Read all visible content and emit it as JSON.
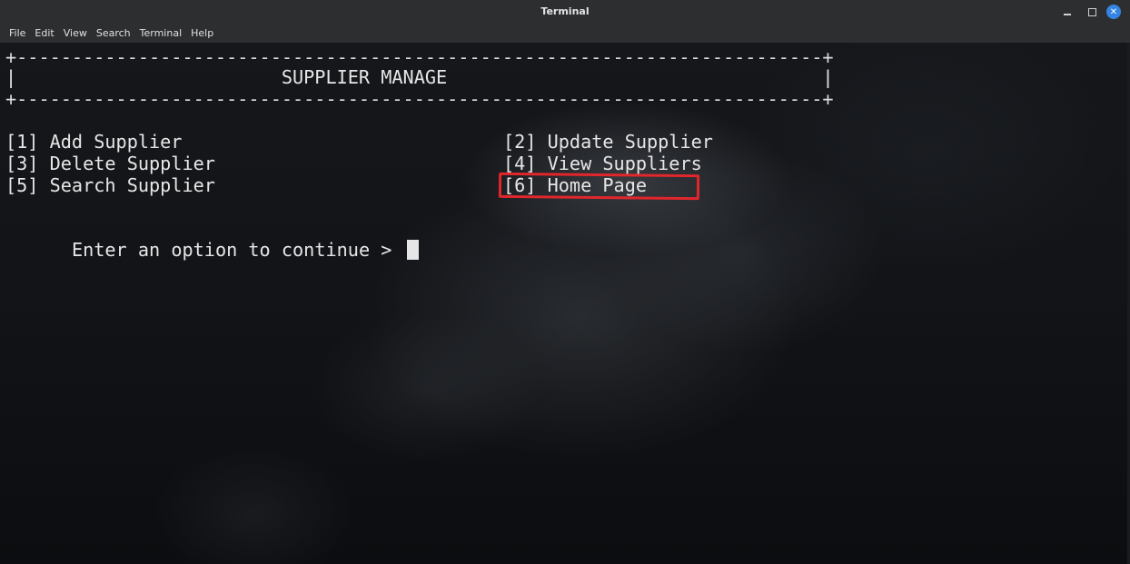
{
  "window": {
    "title": "Terminal"
  },
  "menubar": {
    "items": [
      "File",
      "Edit",
      "View",
      "Search",
      "Terminal",
      "Help"
    ]
  },
  "terminal": {
    "border_top": "+-------------------------------------------------------------------------+",
    "header_line": "|                        SUPPLIER MANAGE                                  |",
    "border_bottom": "+-------------------------------------------------------------------------+",
    "options": [
      {
        "label": "[1] Add Supplier"
      },
      {
        "label": "[2] Update Supplier"
      },
      {
        "label": "[3] Delete Supplier"
      },
      {
        "label": "[4] View Suppliers"
      },
      {
        "label": "[5] Search Supplier"
      },
      {
        "label": "[6] Home Page"
      }
    ],
    "prompt": "Enter an option to continue > "
  },
  "colors": {
    "highlight": "#e1262c",
    "close_button": "#3584e4",
    "terminal_text": "#e6e6e6"
  },
  "icons": {
    "minimize": "minimize-icon",
    "maximize": "maximize-icon",
    "close": "close-icon"
  }
}
